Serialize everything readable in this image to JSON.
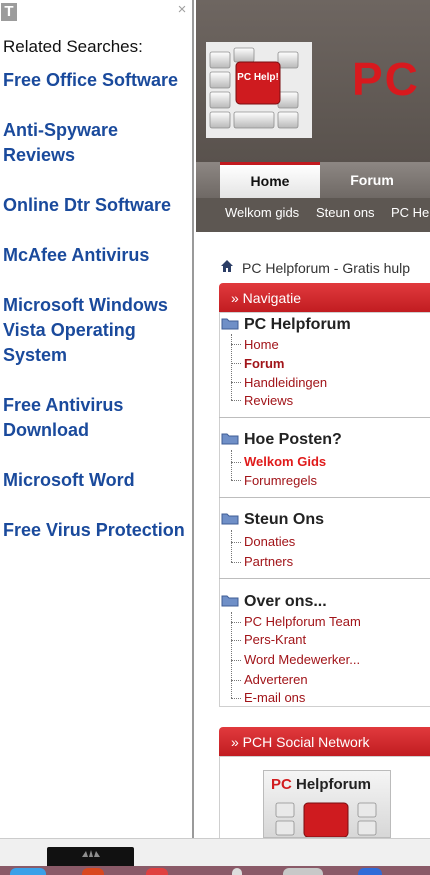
{
  "related": {
    "badge": "T",
    "close": "×",
    "heading": "Related Searches:",
    "links": [
      "Free Office Software",
      "Anti-Spyware Reviews",
      "Online Dtr Software",
      "McAfee Antivirus",
      "Microsoft Windows Vista Operating System",
      "Free Antivirus Download",
      "Microsoft Word",
      "Free Virus Protection"
    ]
  },
  "site": {
    "logo_text": "PC",
    "logo_badge": "PC Help!",
    "nav": {
      "home": "Home",
      "forum": "Forum"
    },
    "subnav": [
      "Welkom gids",
      "Steun ons",
      "PC He"
    ],
    "breadcrumb": "PC Helpforum - Gratis hulp",
    "navigatie_header": "» Navigatie",
    "sections": [
      {
        "title": "PC Helpforum",
        "items": [
          "Home",
          "Forum",
          "Handleidingen",
          "Reviews"
        ]
      },
      {
        "title": "Hoe Posten?",
        "items": [
          "Welkom Gids",
          "Forumregels"
        ]
      },
      {
        "title": "Steun Ons",
        "items": [
          "Donaties",
          "Partners"
        ]
      },
      {
        "title": "Over ons...",
        "items": [
          "PC Helpforum Team",
          "Pers-Krant",
          "Word Medewerker...",
          "Adverteren",
          "E-mail ons"
        ]
      }
    ],
    "social_header": "» PCH Social Network",
    "social_logo": {
      "pc": "PC",
      "rest": " Helpforum"
    }
  },
  "colors": {
    "link_blue": "#1a4a9c",
    "brand_red": "#d8191e",
    "taskbar": "#8a5a68"
  }
}
